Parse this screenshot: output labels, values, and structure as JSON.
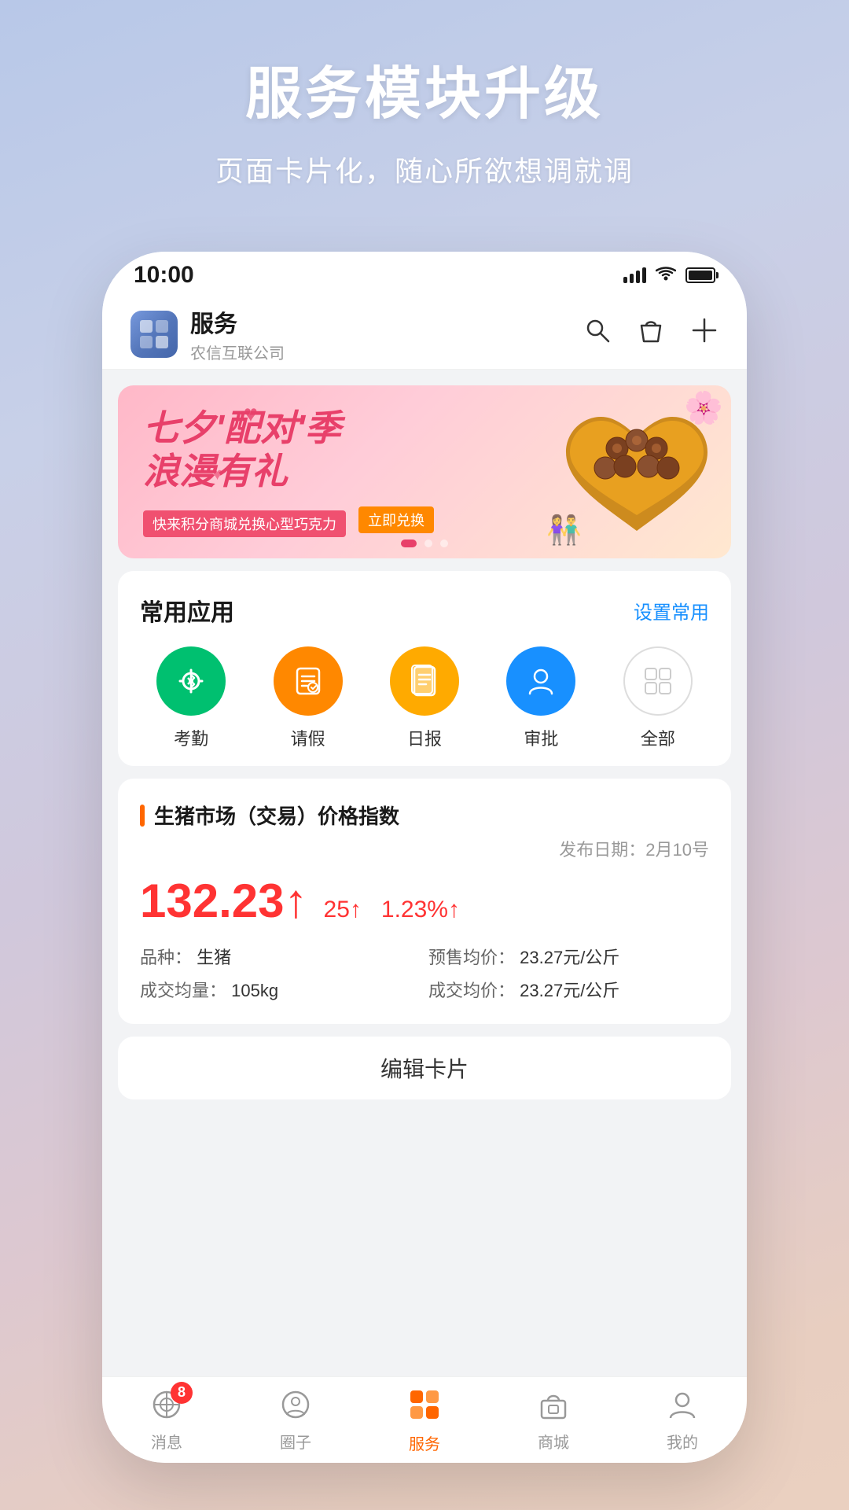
{
  "background": {
    "gradient_start": "#b8c8e8",
    "gradient_end": "#e8d0c8"
  },
  "hero": {
    "title": "服务模块升级",
    "subtitle": "页面卡片化，随心所欲想调就调"
  },
  "status_bar": {
    "time": "10:00",
    "navigation_arrow": "▶"
  },
  "header": {
    "title": "服务",
    "subtitle": "农信互联公司",
    "search_label": "search",
    "bag_label": "bag",
    "add_label": "add"
  },
  "banner": {
    "title_line1": "七夕'配对'季",
    "title_line2": "浪漫有礼",
    "tag_text": "快来积分商城兑换心型巧克力",
    "link_text": "立即兑换",
    "dots": [
      true,
      false,
      false
    ],
    "hearts": [
      "♥",
      "♥"
    ]
  },
  "common_apps": {
    "section_title": "常用应用",
    "action_label": "设置常用",
    "apps": [
      {
        "id": "attendance",
        "label": "考勤",
        "color": "green",
        "icon": "⊙"
      },
      {
        "id": "leave",
        "label": "请假",
        "color": "orange",
        "icon": "📋"
      },
      {
        "id": "daily",
        "label": "日报",
        "color": "yellow",
        "icon": "📄"
      },
      {
        "id": "approval",
        "label": "审批",
        "color": "blue",
        "icon": "👤"
      },
      {
        "id": "all",
        "label": "全部",
        "color": "outline",
        "icon": "⊞"
      }
    ]
  },
  "market_card": {
    "title": "生猪市场（交易）价格指数",
    "date_label": "发布日期：",
    "date_value": "2月10号",
    "price_main": "132.23",
    "price_arrow": "↑",
    "change_value": "25",
    "change_arrow": "↑",
    "change_pct": "1.23%",
    "change_pct_arrow": "↑",
    "detail_breed_label": "品种：",
    "detail_breed_value": "生猪",
    "detail_presell_label": "预售均价：",
    "detail_presell_value": "23.27元/公斤",
    "detail_volume_label": "成交均量：",
    "detail_volume_value": "105kg",
    "detail_price_label": "成交均价：",
    "detail_price_value": "23.27元/公斤"
  },
  "edit_card": {
    "label": "编辑卡片"
  },
  "bottom_nav": {
    "items": [
      {
        "id": "messages",
        "label": "消息",
        "badge": "8",
        "active": false
      },
      {
        "id": "circle",
        "label": "圈子",
        "badge": null,
        "active": false
      },
      {
        "id": "service",
        "label": "服务",
        "badge": null,
        "active": true
      },
      {
        "id": "mall",
        "label": "商城",
        "badge": null,
        "active": false
      },
      {
        "id": "mine",
        "label": "我的",
        "badge": null,
        "active": false
      }
    ]
  }
}
